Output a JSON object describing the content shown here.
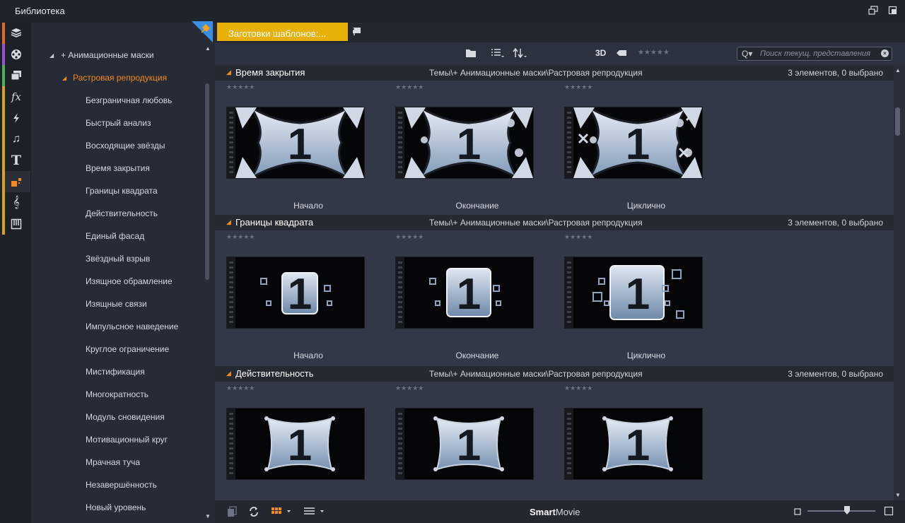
{
  "window": {
    "title": "Библиотека"
  },
  "rail": {
    "items": [
      {
        "name": "project-bins-icon",
        "stripe": "#e06a1a"
      },
      {
        "name": "movie-reel-icon",
        "stripe": "#9b4fd1"
      },
      {
        "name": "photos-icon",
        "stripe": "#4caf50"
      },
      {
        "name": "effects-icon",
        "stripe": "#d9a21a",
        "glyph": "fx"
      },
      {
        "name": "transitions-icon",
        "stripe": "#d9a21a"
      },
      {
        "name": "music-icon",
        "stripe": "#d9a21a",
        "glyph": "♫"
      },
      {
        "name": "titles-icon",
        "stripe": "#d9a21a",
        "glyph": "T"
      },
      {
        "name": "templates-icon",
        "stripe": "#d9a21a"
      },
      {
        "name": "sound-effects-icon",
        "stripe": "#d9a21a",
        "glyph": "𝄞"
      },
      {
        "name": "disc-menus-icon",
        "stripe": "#d9a21a"
      }
    ]
  },
  "tree": {
    "parent": "+ Анимационные маски",
    "selected": "Растровая репродукция",
    "items": [
      "Безграничная любовь",
      "Быстрый анализ",
      "Восходящие звёзды",
      "Время закрытия",
      "Границы квадрата",
      "Действительность",
      "Единый фасад",
      "Звёздный взрыв",
      "Изящное обрамление",
      "Изящные связи",
      "Импульсное наведение",
      "Круглое ограничение",
      "Мистификация",
      "Многократность",
      "Модуль сновидения",
      "Мотивационный круг",
      "Мрачная туча",
      "Незавершённость",
      "Новый уровень"
    ]
  },
  "tabs": {
    "active": "Заготовки шаблонов:..."
  },
  "toolbar": {
    "label_3d": "3D",
    "stars": "★★★★★",
    "search_placeholder": "Поиск текущ. представления",
    "search_icon": "Q▾"
  },
  "groups": [
    {
      "title": "Время закрытия",
      "path": "Темы\\+ Анимационные маски\\Растровая репродукция",
      "count": "3 элементов, 0 выбрано",
      "items": [
        {
          "label": "Начало",
          "stars": "★★★★★"
        },
        {
          "label": "Окончание",
          "stars": "★★★★★"
        },
        {
          "label": "Циклично",
          "stars": "★★★★★"
        }
      ]
    },
    {
      "title": "Границы квадрата",
      "path": "Темы\\+ Анимационные маски\\Растровая репродукция",
      "count": "3 элементов, 0 выбрано",
      "items": [
        {
          "label": "Начало",
          "stars": "★★★★★"
        },
        {
          "label": "Окончание",
          "stars": "★★★★★"
        },
        {
          "label": "Циклично",
          "stars": "★★★★★"
        }
      ]
    },
    {
      "title": "Действительность",
      "path": "Темы\\+ Анимационные маски\\Растровая репродукция",
      "count": "",
      "items": [
        {
          "label": "",
          "stars": "★★★★★"
        },
        {
          "label": "",
          "stars": "★★★★★"
        },
        {
          "label": "",
          "stars": "★★★★★"
        }
      ]
    }
  ],
  "group3_count": "3 элементов, 0 выбрано",
  "thumb_digit": "1",
  "bottombar": {
    "brand_bold": "Smart",
    "brand_rest": "Movie"
  }
}
